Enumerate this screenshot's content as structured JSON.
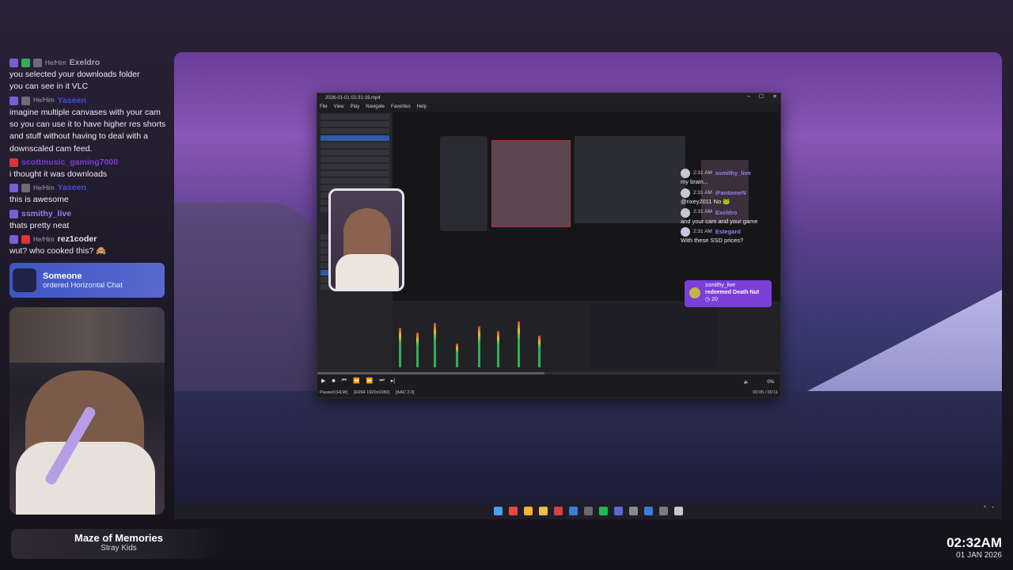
{
  "chat": {
    "messages": [
      {
        "pronoun": "He/Him",
        "user": "Exeldro",
        "user_color": "#a9a2b6",
        "text": "you selected your downloads folder",
        "badges": [
          "purple",
          "green",
          "grey"
        ]
      },
      {
        "pronoun": "",
        "user": "",
        "user_color": "#ffffff",
        "text": "you can see in it VLC",
        "badges": []
      },
      {
        "pronoun": "He/Him",
        "user": "Yaseen",
        "user_color": "#3f4fd8",
        "text": "imagine multiple canvases with your cam so you can use it to have higher res shorts and stuff without having to deal with a downscaled cam feed.",
        "badges": [
          "purple",
          "grey"
        ]
      },
      {
        "pronoun": "",
        "user": "scottmusic_gaming7000",
        "user_color": "#7b3ad6",
        "text": "i thought it was downloads",
        "badges": [
          "red"
        ]
      },
      {
        "pronoun": "He/Him",
        "user": "Yaseen",
        "user_color": "#3f4fd8",
        "text": "this is awesome",
        "badges": [
          "purple",
          "grey"
        ]
      },
      {
        "pronoun": "",
        "user": "ssmithy_live",
        "user_color": "#9a7cf0",
        "text": "thats pretty neat",
        "badges": [
          "purple"
        ]
      },
      {
        "pronoun": "He/Him",
        "user": "rez1coder",
        "user_color": "#e6e2ee",
        "text": "wut? who cooked this? 🙈",
        "badges": [
          "purple",
          "red"
        ]
      }
    ]
  },
  "alert": {
    "name": "Someone",
    "action": "ordered Horizontal Chat"
  },
  "now_playing": {
    "title": "Maze of Memories",
    "artist": "Stray Kids"
  },
  "clock": {
    "time": "02:32AM",
    "date": "01 JAN 2026"
  },
  "vlc": {
    "title": "2026-01-01 02-31-19.mp4",
    "menu": [
      "File",
      "View",
      "Play",
      "Navigate",
      "Favorites",
      "Help"
    ],
    "window_buttons": [
      "–",
      "☐",
      "✕"
    ],
    "status_left": "Paused [HLW]",
    "codec_video": "[H264 1920x1080]",
    "codec_audio": "[AAC 2.0]",
    "time": "00:05 / 00:11",
    "volume": "0%",
    "progress": 0.49
  },
  "nested_chat": {
    "messages": [
      {
        "time": "2:31 AM",
        "user": "ssmithy_live",
        "text": "my brain..."
      },
      {
        "time": "2:31 AM",
        "user": "iFantomeN",
        "text": "@rixey2011 No 🐸"
      },
      {
        "time": "2:31 AM",
        "user": "Exeldro",
        "text": "and your cam and your game"
      },
      {
        "time": "2:31 AM",
        "user": "Estegard",
        "text": "With these SSD prices?"
      }
    ],
    "redeem": {
      "user": "ssmithy_live",
      "action": "redeemed Death Nut",
      "points": "20"
    }
  },
  "colors": {
    "accent": "#7a3fd8",
    "alert": "#4b5fcf",
    "chat_purple": "#9a7cf0"
  }
}
